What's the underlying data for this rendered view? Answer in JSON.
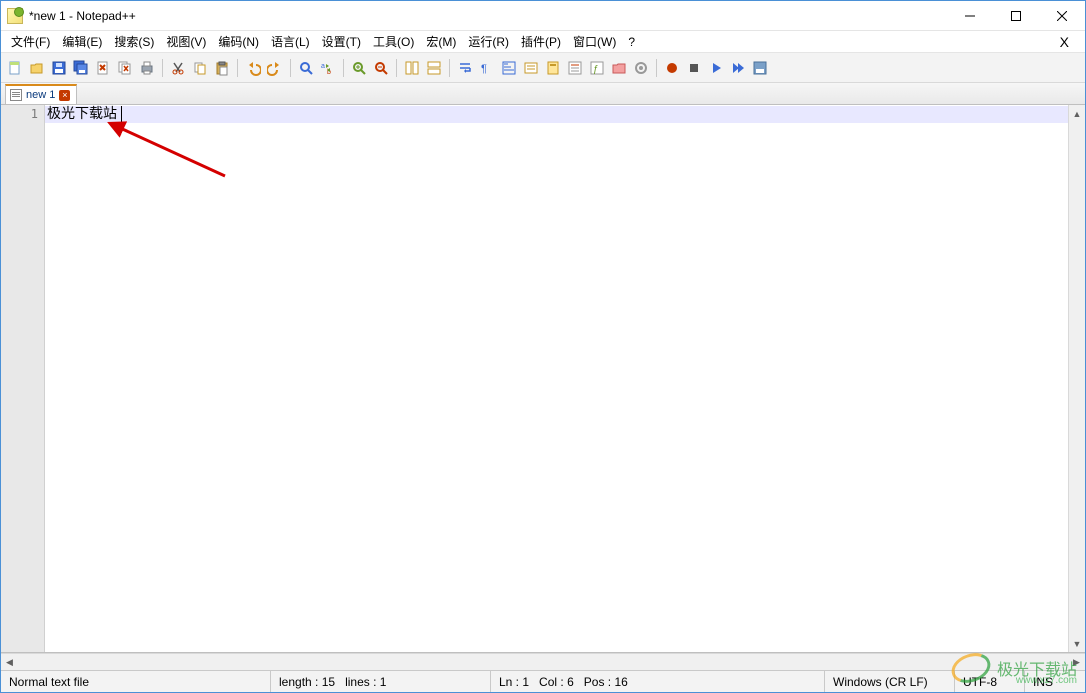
{
  "title": "*new 1 - Notepad++",
  "menus": [
    "文件(F)",
    "编辑(E)",
    "搜索(S)",
    "视图(V)",
    "编码(N)",
    "语言(L)",
    "设置(T)",
    "工具(O)",
    "宏(M)",
    "运行(R)",
    "插件(P)",
    "窗口(W)",
    "?"
  ],
  "toolbar_icons": [
    "new-file-icon",
    "open-file-icon",
    "save-icon",
    "save-all-icon",
    "close-icon",
    "close-all-icon",
    "print-icon",
    "sep",
    "cut-icon",
    "copy-icon",
    "paste-icon",
    "sep",
    "undo-icon",
    "redo-icon",
    "sep",
    "find-icon",
    "replace-icon",
    "sep",
    "zoom-in-icon",
    "zoom-out-icon",
    "sep",
    "sync-v-icon",
    "sync-h-icon",
    "sep",
    "wordwrap-icon",
    "show-all-icon",
    "indent-guide-icon",
    "udl-icon",
    "doc-map-icon",
    "doc-list-icon",
    "func-list-icon",
    "folder-icon",
    "monitor-icon",
    "sep",
    "record-macro-icon",
    "stop-macro-icon",
    "play-macro-icon",
    "play-multi-icon",
    "save-macro-icon"
  ],
  "tab": {
    "label": "new 1",
    "dirty": true
  },
  "editor": {
    "line_number": "1",
    "content": "极光下载站"
  },
  "status": {
    "filetype": "Normal text file",
    "length_label": "length :",
    "length": "15",
    "lines_label": "lines :",
    "lines": "1",
    "ln_label": "Ln :",
    "ln": "1",
    "col_label": "Col :",
    "col": "6",
    "pos_label": "Pos :",
    "pos": "16",
    "eol": "Windows (CR LF)",
    "encoding": "UTF-8",
    "mode": "INS"
  },
  "watermark": {
    "name": "极光下载站",
    "url": "www.xz7.com"
  }
}
